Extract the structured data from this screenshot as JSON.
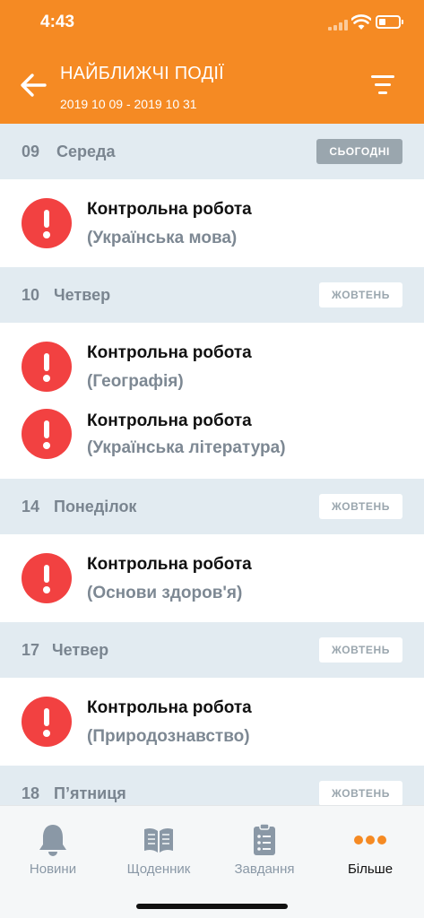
{
  "status": {
    "time": "4:43"
  },
  "header": {
    "title": "НАЙБЛИЖЧІ ПОДІЇ",
    "date_range": "2019 10 09 - 2019 10 31"
  },
  "days": [
    {
      "num": "09",
      "name": "Середа",
      "badge": "СЬОГОДНІ",
      "events": [
        {
          "title": "Контрольна робота",
          "subject": "(Українська мова)"
        }
      ]
    },
    {
      "num": "10",
      "name": "Четвер",
      "badge": "ЖОВТЕНЬ",
      "events": [
        {
          "title": "Контрольна робота",
          "subject": "(Географія)"
        },
        {
          "title": "Контрольна робота",
          "subject": "(Українська література)"
        }
      ]
    },
    {
      "num": "14",
      "name": "Понеділок",
      "badge": "ЖОВТЕНЬ",
      "events": [
        {
          "title": "Контрольна робота",
          "subject": "(Основи здоров'я)"
        }
      ]
    },
    {
      "num": "17",
      "name": "Четвер",
      "badge": "ЖОВТЕНЬ",
      "events": [
        {
          "title": "Контрольна робота",
          "subject": "(Природознавство)"
        }
      ]
    },
    {
      "num": "18",
      "name": "П’ятниця",
      "badge": "ЖОВТЕНЬ",
      "events": []
    }
  ],
  "tabs": [
    {
      "label": "Новини",
      "icon": "bell-icon"
    },
    {
      "label": "Щоденник",
      "icon": "book-icon"
    },
    {
      "label": "Завдання",
      "icon": "clipboard-icon"
    },
    {
      "label": "Більше",
      "icon": "more-dots-icon"
    }
  ],
  "colors": {
    "accent": "#F58A23",
    "alert": "#F24141",
    "day_header_bg": "#E2EBF1"
  }
}
